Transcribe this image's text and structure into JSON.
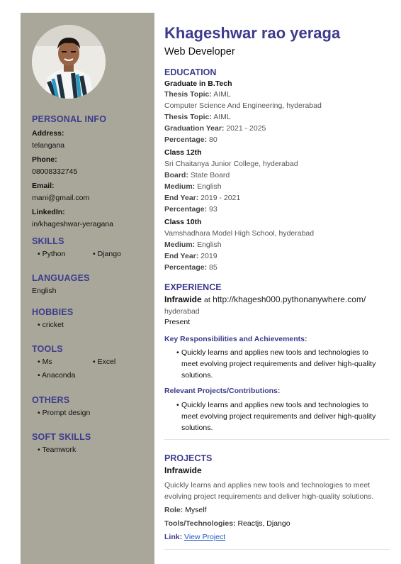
{
  "profile": {
    "name": "Khageshwar rao yeraga",
    "title": "Web Developer"
  },
  "personal": {
    "heading": "PERSONAL INFO",
    "address_label": "Address:",
    "address": "telangana",
    "phone_label": "Phone:",
    "phone": "08008332745",
    "email_label": "Email:",
    "email": "mani@gmail.com",
    "linkedin_label": "LinkedIn:",
    "linkedin": "in/khageshwar-yeragana"
  },
  "skills": {
    "heading": "SKILLS",
    "items": [
      "Python",
      "Django"
    ]
  },
  "languages": {
    "heading": "LANGUAGES",
    "items": [
      "English"
    ]
  },
  "hobbies": {
    "heading": "HOBBIES",
    "items": [
      "cricket"
    ]
  },
  "tools": {
    "heading": "TOOLS",
    "items": [
      "Ms",
      "Excel",
      "Anaconda"
    ]
  },
  "others": {
    "heading": "OTHERS",
    "items": [
      "Prompt design"
    ]
  },
  "soft_skills": {
    "heading": "SOFT SKILLS",
    "items": [
      "Teamwork"
    ]
  },
  "education": {
    "heading": "EDUCATION",
    "degree": {
      "title": "Graduate in B.Tech",
      "thesis_label": "Thesis Topic:",
      "thesis": "AIML",
      "college": "Computer Science And Engineering, hyderabad",
      "thesis2_label": "Thesis Topic:",
      "thesis2": "AIML",
      "year_label": "Graduation Year:",
      "year": "2021 - 2025",
      "pct_label": "Percentage:",
      "pct": "80"
    },
    "class12": {
      "title": "Class 12th",
      "school": "Sri Chaitanya Junior College, hyderabad",
      "board_label": "Board:",
      "board": "State Board",
      "medium_label": "Medium:",
      "medium": "English",
      "end_label": "End Year:",
      "end": "2019 - 2021",
      "pct_label": "Percentage:",
      "pct": "93"
    },
    "class10": {
      "title": "Class 10th",
      "school": "Vamshadhara Model High School, hyderabad",
      "medium_label": "Medium:",
      "medium": "English",
      "end_label": "End Year:",
      "end": "2019",
      "pct_label": "Percentage:",
      "pct": "85"
    }
  },
  "experience": {
    "heading": "EXPERIENCE",
    "company": "Infrawide",
    "at": "at",
    "url": "http://khagesh000.pythonanywhere.com/",
    "location": "hyderabad",
    "period": "Present",
    "resp_heading": "Key Responsibilities and Achievements:",
    "resp": "Quickly learns and applies new tools and technologies to meet evolving project requirements and deliver high-quality solutions.",
    "proj_heading": "Relevant Projects/Contributions:",
    "proj": "Quickly learns and applies new tools and technologies to meet evolving project requirements and deliver high-quality solutions."
  },
  "projects": {
    "heading": "PROJECTS",
    "name": "Infrawide",
    "desc": "Quickly learns and applies new tools and technologies to meet evolving project requirements and deliver high-quality solutions.",
    "role_label": "Role:",
    "role": "Myself",
    "tech_label": "Tools/Technologies:",
    "tech": "Reactjs, Django",
    "link_label": "Link:",
    "link_text": "View Project"
  },
  "colors": {
    "sidebar": "#a8a799",
    "accent": "#3d3b8e",
    "link": "#1a56c8"
  }
}
